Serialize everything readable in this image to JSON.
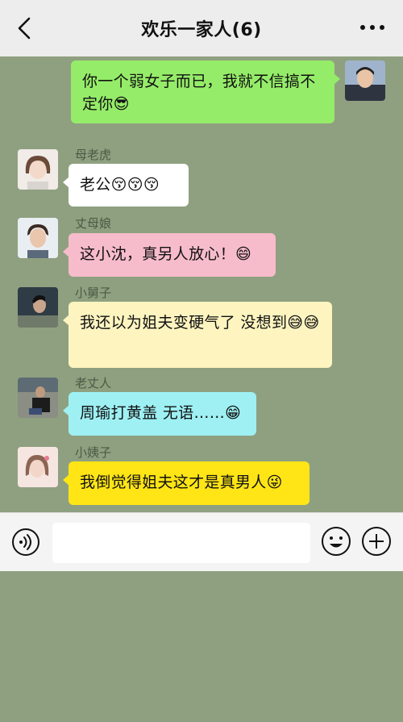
{
  "header": {
    "title": "欢乐一家人(6)"
  },
  "messages": [
    {
      "side": "right",
      "sender": "",
      "text": "你一个弱女子而已，我就不信搞不定你😎",
      "color": "#95ec69"
    },
    {
      "side": "left",
      "sender": "母老虎",
      "text": "老公😚😚😚",
      "color": "#ffffff"
    },
    {
      "side": "left",
      "sender": "丈母娘",
      "text": "这小沈，真另人放心！😄",
      "color": "#f7bccb"
    },
    {
      "side": "left",
      "sender": "小舅子",
      "text": "我还以为姐夫变硬气了 没想到😅😅",
      "color": "#fdf4c0"
    },
    {
      "side": "left",
      "sender": "老丈人",
      "text": "周瑜打黄盖  无语……😁",
      "color": "#9ef0f3"
    },
    {
      "side": "left",
      "sender": "小姨子",
      "text": "我倒觉得姐夫这才是真男人😜",
      "color": "#ffe516"
    }
  ],
  "input": {
    "value": "",
    "placeholder": ""
  },
  "icons": {
    "back": "chevron-left-icon",
    "more": "more-dots-icon",
    "voice": "voice-icon",
    "emoji": "emoji-icon",
    "plus": "plus-icon"
  },
  "colors": {
    "chat_background": "#8fa080",
    "header_background": "#ededed",
    "input_bar_background": "#f4f4f4"
  }
}
